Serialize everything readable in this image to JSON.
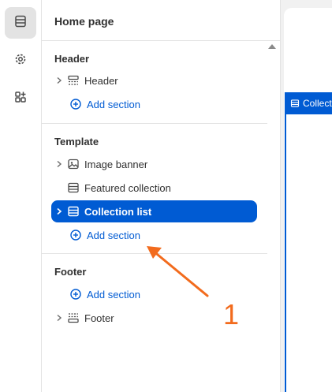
{
  "rail": {
    "items": [
      {
        "icon": "sections-icon",
        "active": true
      },
      {
        "icon": "settings-icon",
        "active": false
      },
      {
        "icon": "apps-icon",
        "active": false
      }
    ]
  },
  "panel": {
    "title": "Home page",
    "groups": {
      "header": {
        "title": "Header",
        "items": [
          {
            "label": "Header",
            "icon": "header-section-icon"
          }
        ],
        "add_label": "Add section"
      },
      "template": {
        "title": "Template",
        "items": [
          {
            "label": "Image banner",
            "icon": "image-icon"
          },
          {
            "label": "Featured collection",
            "icon": "collection-icon"
          },
          {
            "label": "Collection list",
            "icon": "collection-icon",
            "selected": true
          }
        ],
        "add_label": "Add section"
      },
      "footer": {
        "title": "Footer",
        "items": [
          {
            "label": "Footer",
            "icon": "footer-section-icon"
          }
        ],
        "add_label": "Add section"
      }
    }
  },
  "preview": {
    "tag_label": "Collection list"
  },
  "annotation": {
    "number": "1",
    "color": "#f26b1d"
  },
  "colors": {
    "accent": "#005bd3",
    "annotation": "#f26b1d"
  }
}
